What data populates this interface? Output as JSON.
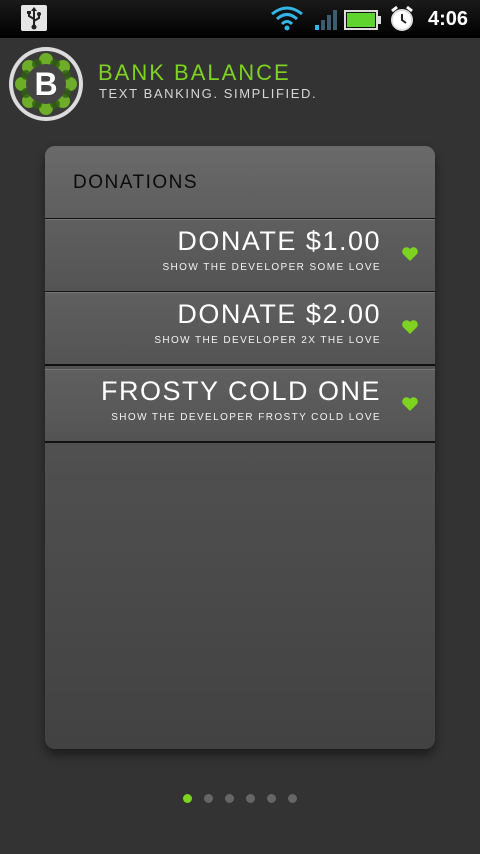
{
  "status_bar": {
    "time": "4:06",
    "icons": [
      "usb-icon",
      "wifi-icon",
      "signal-icon",
      "battery-icon",
      "alarm-icon"
    ]
  },
  "header": {
    "logo_letter": "B",
    "title": "BANK BALANCE",
    "subtitle": "TEXT BANKING. SIMPLIFIED."
  },
  "card": {
    "title": "DONATIONS",
    "items": [
      {
        "title": "DONATE $1.00",
        "subtitle": "SHOW THE DEVELOPER SOME LOVE",
        "icon": "heart-icon"
      },
      {
        "title": "DONATE $2.00",
        "subtitle": "SHOW THE DEVELOPER 2X THE LOVE",
        "icon": "heart-icon"
      },
      {
        "title": "FROSTY COLD ONE",
        "subtitle": "SHOW THE DEVELOPER FROSTY COLD LOVE",
        "icon": "heart-icon"
      }
    ]
  },
  "pager": {
    "pages": 6,
    "active": 1
  },
  "colors": {
    "accent": "#7ed321",
    "background": "#333333",
    "card": "#555555"
  }
}
